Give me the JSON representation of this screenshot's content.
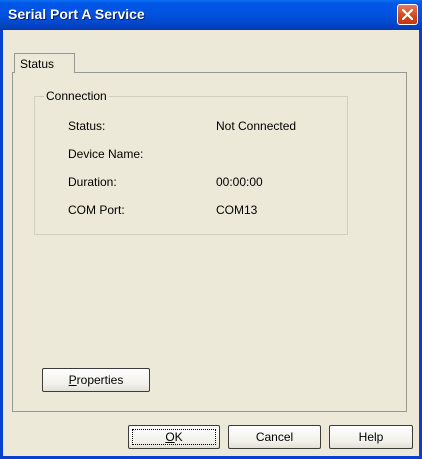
{
  "window": {
    "title": "Serial Port A Service"
  },
  "tabs": [
    {
      "label": "Status"
    }
  ],
  "connection": {
    "group_label": "Connection",
    "fields": [
      {
        "label": "Status:",
        "value": "Not Connected"
      },
      {
        "label": "Device Name:",
        "value": ""
      },
      {
        "label": "Duration:",
        "value": "00:00:00"
      },
      {
        "label": "COM Port:",
        "value": "COM13"
      }
    ]
  },
  "buttons": {
    "properties": {
      "mnemonic": "P",
      "rest": "roperties"
    },
    "ok": {
      "mnemonic": "O",
      "rest": "K"
    },
    "cancel": "Cancel",
    "help": "Help"
  },
  "icons": {
    "close": "close-icon"
  },
  "colors": {
    "titlebar": "#0053e1",
    "close_button": "#d3461d",
    "dialog_bg": "#ece9d8"
  }
}
